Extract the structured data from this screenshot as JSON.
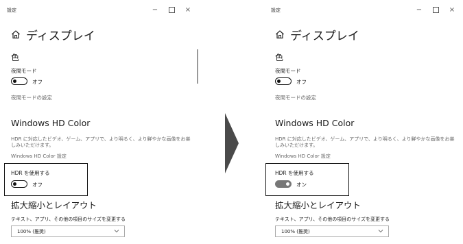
{
  "left": {
    "window_title": "設定",
    "page_title": "ディスプレイ",
    "section_color": "色",
    "night_mode_label": "夜間モード",
    "night_toggle_state": "オフ",
    "night_settings_link": "夜間モードの設定",
    "hd_heading": "Windows HD Color",
    "hd_description": "HDR に対応したビデオ、ゲーム、アプリで、より明るく、より鮮やかな画像をお楽しみいただけます。",
    "hd_settings_link": "Windows HD Color 設定",
    "hdr_label": "HDR を使用する",
    "hdr_toggle_state": "オフ",
    "scale_heading": "拡大縮小とレイアウト",
    "scale_label": "テキスト、アプリ、その他の項目のサイズを変更する",
    "scale_value": "100% (推奨)"
  },
  "right": {
    "window_title": "設定",
    "page_title": "ディスプレイ",
    "section_color": "色",
    "night_mode_label": "夜間モード",
    "night_toggle_state": "オフ",
    "night_settings_link": "夜間モードの設定",
    "hd_heading": "Windows HD Color",
    "hd_description": "HDR に対応したビデオ、ゲーム、アプリで、より明るく、より鮮やかな画像をお楽しみいただけます。",
    "hd_settings_link": "Windows HD Color 設定",
    "hdr_label": "HDR を使用する",
    "hdr_toggle_state": "オン",
    "scale_heading": "拡大縮小とレイアウト",
    "scale_label": "テキスト、アプリ、その他の項目のサイズを変更する",
    "scale_value": "100% (推奨)"
  },
  "window_controls": {
    "minimize": "−",
    "close": "×"
  },
  "colors": {
    "accent_arrow": "#4a4a4a",
    "toggle_on": "#777777"
  },
  "toggles": {
    "left_night": false,
    "left_hdr": false,
    "right_night": false,
    "right_hdr": true
  }
}
